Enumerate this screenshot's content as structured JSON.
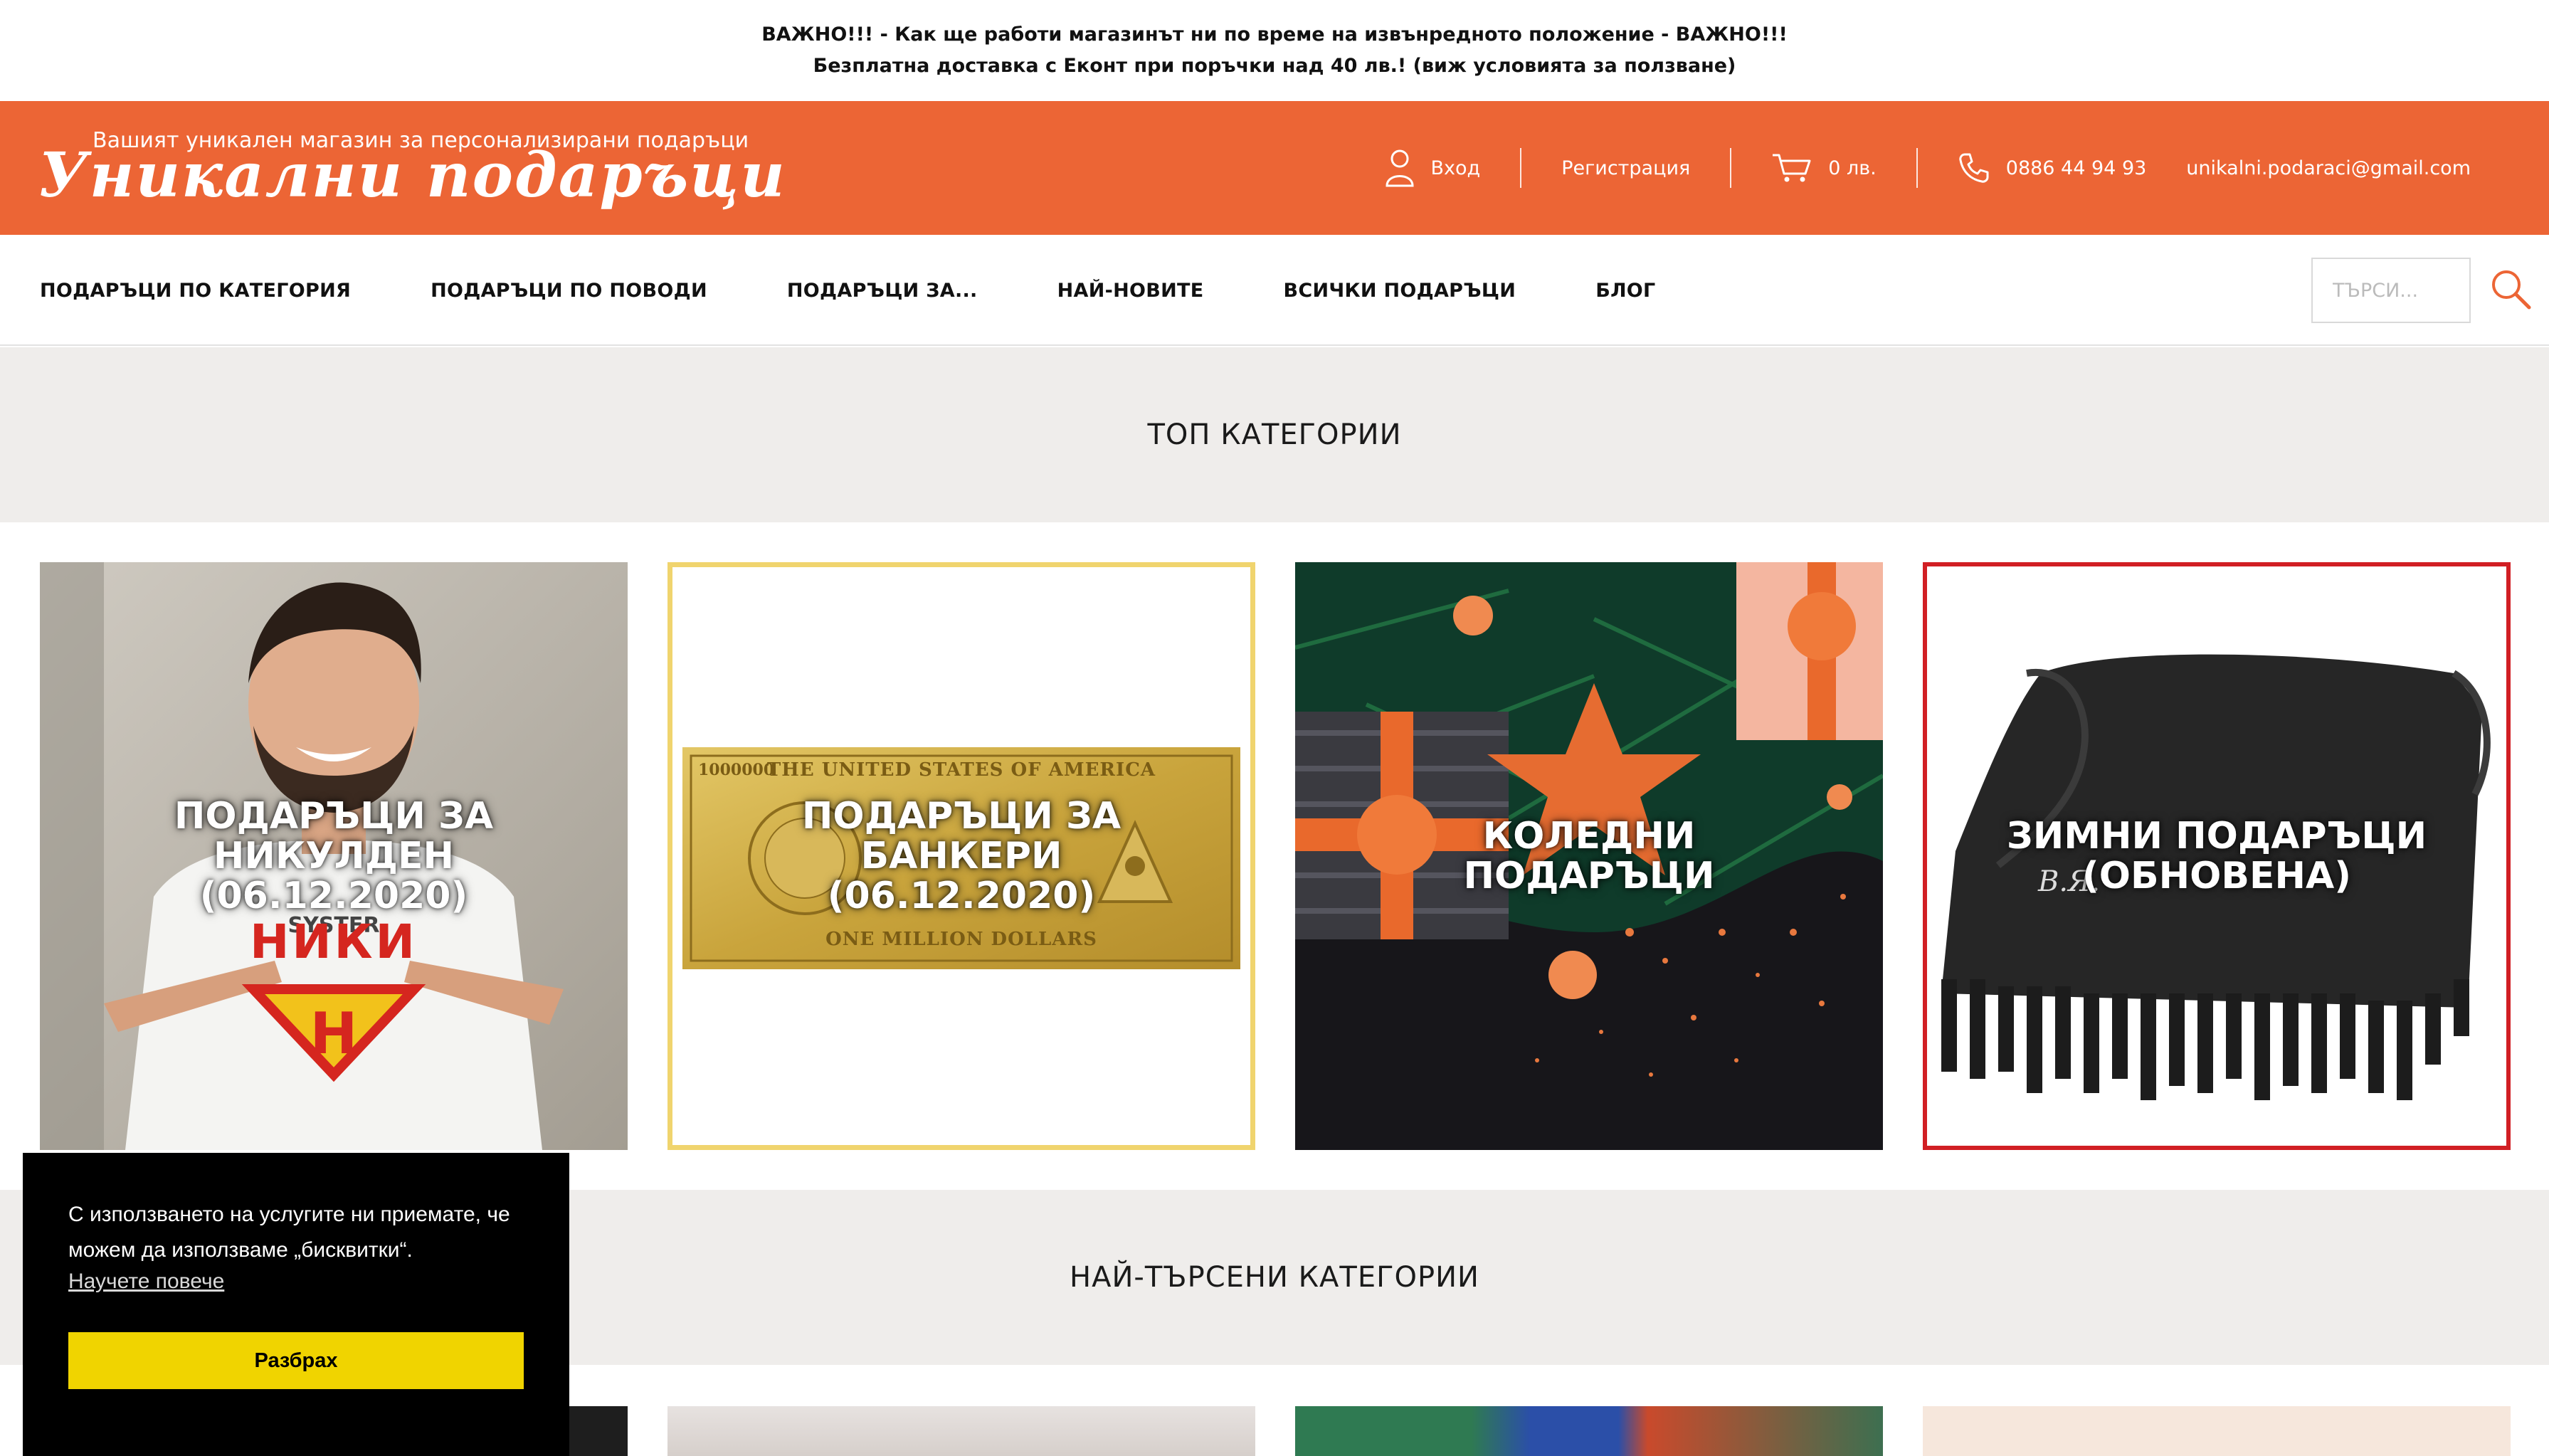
{
  "announcement": {
    "line1": "ВАЖНО!!! - Как ще работи магазинът ни по време на извънредното положение - ВАЖНО!!!",
    "line2": "Безплатна доставка с Еконт при поръчки над 40 лв.! (виж условията за ползване)"
  },
  "header": {
    "logo_text": "Уникални подаръци",
    "tagline": "Вашият уникален магазин за персонализирани подаръци",
    "login": "Вход",
    "register": "Регистрация",
    "cart_total": "0 лв.",
    "phone": "0886 44 94 93",
    "email": "unikalni.podaraci@gmail.com",
    "accent_color": "#ec6535"
  },
  "nav": {
    "items": [
      "ПОДАРЪЦИ ПО КАТЕГОРИЯ",
      "ПОДАРЪЦИ ПО ПОВОДИ",
      "ПОДАРЪЦИ ЗА...",
      "НАЙ-НОВИТЕ",
      "ВСИЧКИ ПОДАРЪЦИ",
      "БЛОГ"
    ],
    "search_placeholder": "ТЪРСИ..."
  },
  "top_categories": {
    "title": "ТОП КАТЕГОРИИ",
    "tiles": [
      {
        "label": "ПОДАРЪЦИ ЗА\nНИКУЛДЕН\n(06.12.2020)",
        "shirt_text": "НИКИ"
      },
      {
        "label": "ПОДАРЪЦИ ЗА\nБАНКЕРИ\n(06.12.2020)",
        "note_top": "THE UNITED STATES OF AMERICA",
        "note_bottom": "ONE MILLION DOLLARS",
        "note_value": "1000000"
      },
      {
        "label": "КОЛЕДНИ\nПОДАРЪЦИ"
      },
      {
        "label": "ЗИМНИ ПОДАРЪЦИ\n(ОБНОВЕНА)",
        "scarf_initials": "В.Я."
      }
    ]
  },
  "most_searched": {
    "title": "НАЙ-ТЪРСЕНИ КАТЕГОРИИ"
  },
  "cookie": {
    "text": "С използването на услугите ни приемате, че можем да използваме „бисквитки“.",
    "link": "Научете повече",
    "button": "Разбрах"
  }
}
